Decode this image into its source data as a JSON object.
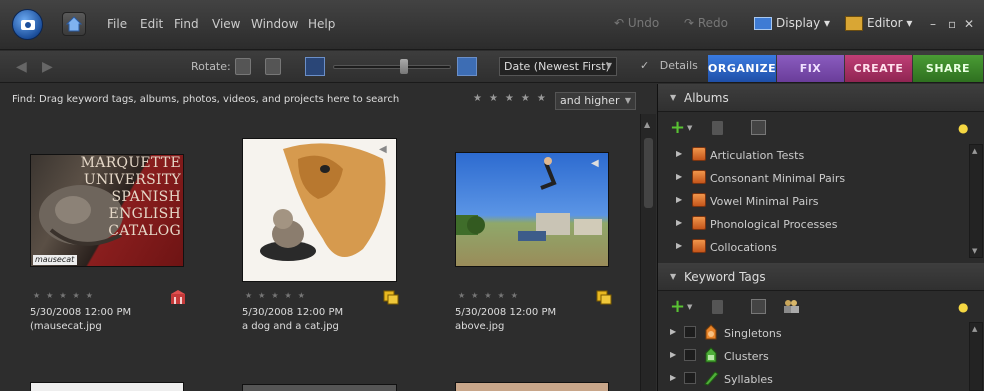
{
  "menu": {
    "items": [
      "File",
      "Edit",
      "Find",
      "View",
      "Window",
      "Help"
    ]
  },
  "topbar": {
    "undo": "Undo",
    "redo": "Redo",
    "display": "Display",
    "editor": "Editor"
  },
  "toolbar": {
    "rotate_label": "Rotate:",
    "sort_value": "Date (Newest First)",
    "details_label": "Details",
    "details_checked": true
  },
  "tabs": [
    {
      "label": "ORGANIZE",
      "color": "#2a64c5"
    },
    {
      "label": "FIX",
      "color": "#8a4fb8"
    },
    {
      "label": "CREATE",
      "color": "#b8336a"
    },
    {
      "label": "SHARE",
      "color": "#3f8f2b"
    }
  ],
  "find": {
    "instruction": "Find: Drag keyword tags, albums, photos, videos, and projects here to search",
    "rating_stars": "★★★★★",
    "rating_filter": "and higher"
  },
  "photos": [
    {
      "stars": "★★★★★",
      "date": "5/30/2008 12:00 PM",
      "name": "(mausecat.jpg",
      "tag_icon": "album-tag-icon",
      "overlay_lines": [
        "MARQUETTE",
        "UNIVERSITY",
        "SPANISH",
        "ENGLISH",
        "CATALOG"
      ],
      "caption": "mausecat"
    },
    {
      "stars": "★★★★★",
      "date": "5/30/2008 12:00 PM",
      "name": "a dog and a cat.jpg",
      "tag_icon": "keyword-tag-icon"
    },
    {
      "stars": "★★★★★",
      "date": "5/30/2008 12:00 PM",
      "name": "above.jpg",
      "tag_icon": "keyword-tag-icon"
    }
  ],
  "albums": {
    "title": "Albums",
    "items": [
      "Articulation Tests",
      "Consonant Minimal Pairs",
      "Vowel Minimal Pairs",
      "Phonological Processes",
      "Collocations"
    ]
  },
  "keywords": {
    "title": "Keyword Tags",
    "items": [
      {
        "label": "Singletons",
        "icon": "singletons-tag-icon",
        "color": "#e8842a"
      },
      {
        "label": "Clusters",
        "icon": "clusters-tag-icon",
        "color": "#4fae3a"
      },
      {
        "label": "Syllables",
        "icon": "syllables-tag-icon",
        "color": "#4fae3a"
      }
    ]
  }
}
